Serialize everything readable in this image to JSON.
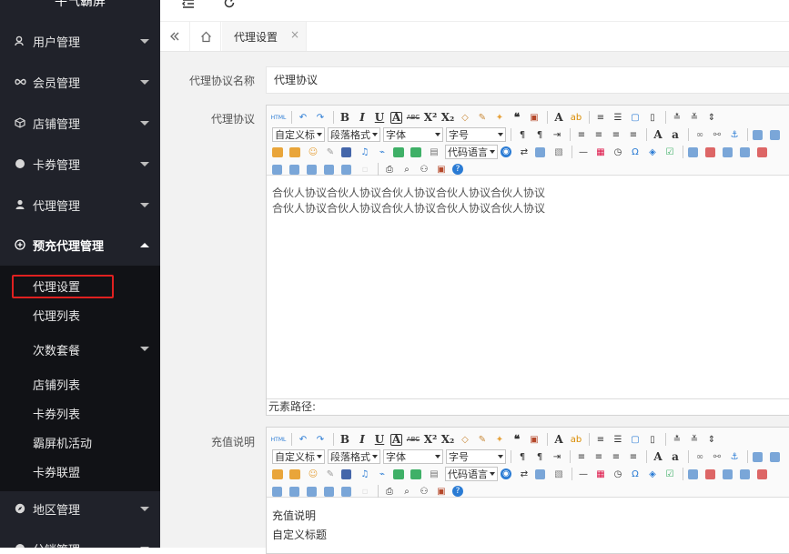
{
  "sidebar": {
    "logo": "牛气霸屏",
    "items": [
      {
        "label": "用户管理",
        "icon": "user-icon"
      },
      {
        "label": "会员管理",
        "icon": "infinity-icon"
      },
      {
        "label": "店铺管理",
        "icon": "box-icon"
      },
      {
        "label": "卡券管理",
        "icon": "circle-icon"
      },
      {
        "label": "代理管理",
        "icon": "person-icon"
      },
      {
        "label": "预充代理管理",
        "icon": "plus-circle-icon"
      },
      {
        "label": "地区管理",
        "icon": "compass-icon"
      },
      {
        "label": "分销管理",
        "icon": "share-icon"
      }
    ],
    "submenu": [
      {
        "label": "代理设置"
      },
      {
        "label": "代理列表"
      },
      {
        "label": "次数套餐"
      },
      {
        "label": "店铺列表"
      },
      {
        "label": "卡券列表"
      },
      {
        "label": "霸屏机活动"
      },
      {
        "label": "卡券联盟"
      }
    ]
  },
  "topbar": {
    "menu_icon": "menu-fold-icon",
    "refresh_icon": "refresh-icon"
  },
  "tabs": {
    "prev_icon": "double-chevron-left-icon",
    "home_icon": "home-icon",
    "active": {
      "label": "代理设置",
      "close": "×"
    }
  },
  "form": {
    "name_label": "代理协议名称",
    "name_value": "代理协议",
    "agreement_label": "代理协议",
    "agreement_lines": [
      "合伙人协议合伙人协议合伙人协议合伙人协议合伙人协议",
      "合伙人协议合伙人协议合伙人协议合伙人协议合伙人协议"
    ],
    "element_path": "元素路径:",
    "recharge_label": "充值说明",
    "recharge_lines": [
      "充值说明",
      "自定义标题"
    ]
  },
  "editor": {
    "select_custom": "自定义标",
    "select_paragraph": "段落格式",
    "select_font": "字体",
    "select_size": "字号",
    "select_code": "代码语言"
  },
  "colors": {
    "sidebar": "#20222a",
    "submenu": "#111216",
    "highlight": "#e02020"
  }
}
